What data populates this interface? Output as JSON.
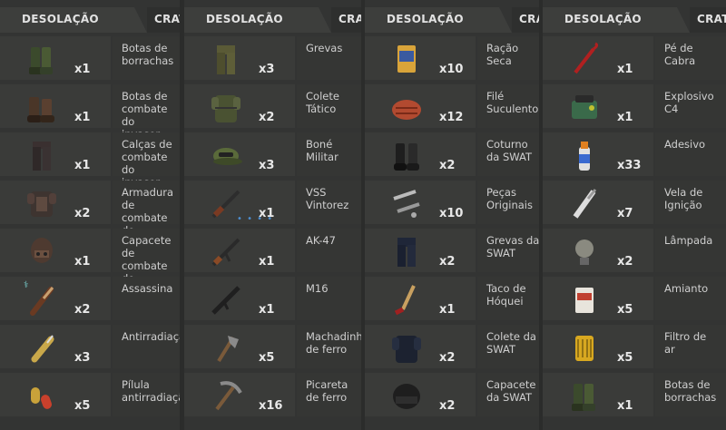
{
  "panels": [
    {
      "tab": "DESOLAÇÃO",
      "crate": "CRATE",
      "items": [
        {
          "name": "Botas de borrachas",
          "qty": "x1",
          "icon": "rubber-boots-icon"
        },
        {
          "name": "Botas de combate do invasor",
          "qty": "x1",
          "icon": "combat-boots-icon"
        },
        {
          "name": "Calças de combate do invasor",
          "qty": "x1",
          "icon": "combat-pants-icon"
        },
        {
          "name": "Armadura de combate do invasor",
          "qty": "x2",
          "icon": "combat-armor-icon"
        },
        {
          "name": "Capacete de combate do invasor",
          "qty": "x1",
          "icon": "combat-helmet-icon"
        },
        {
          "name": "Assassina",
          "qty": "x2",
          "icon": "assassin-knife-icon",
          "badge": "⚕"
        },
        {
          "name": "Antirradiação",
          "qty": "x3",
          "icon": "anti-radiation-icon"
        },
        {
          "name": "Pílula antirradiação",
          "qty": "x5",
          "icon": "pill-icon"
        }
      ]
    },
    {
      "tab": "DESOLAÇÃO",
      "crate": "CRATE",
      "items": [
        {
          "name": "Grevas",
          "qty": "x3",
          "icon": "greaves-icon"
        },
        {
          "name": "Colete Tático",
          "qty": "x2",
          "icon": "tactical-vest-icon"
        },
        {
          "name": "Boné Militar",
          "qty": "x3",
          "icon": "military-cap-icon"
        },
        {
          "name": "VSS Vintorez",
          "qty": "x1",
          "icon": "vss-rifle-icon",
          "dots": "• • • •"
        },
        {
          "name": "AK-47",
          "qty": "x1",
          "icon": "ak47-icon"
        },
        {
          "name": "M16",
          "qty": "x1",
          "icon": "m16-icon"
        },
        {
          "name": "Machadinha de ferro",
          "qty": "x5",
          "icon": "iron-hatchet-icon"
        },
        {
          "name": "Picareta de ferro",
          "qty": "x16",
          "icon": "iron-pickaxe-icon"
        }
      ]
    },
    {
      "tab": "DESOLAÇÃO",
      "crate": "CRATE",
      "items": [
        {
          "name": "Ração Seca",
          "qty": "x10",
          "icon": "dry-ration-icon"
        },
        {
          "name": "Filé Suculento",
          "qty": "x12",
          "icon": "steak-icon"
        },
        {
          "name": "Coturno da SWAT",
          "qty": "x2",
          "icon": "swat-boots-icon"
        },
        {
          "name": "Peças Originais",
          "qty": "x10",
          "icon": "original-parts-icon"
        },
        {
          "name": "Grevas da SWAT",
          "qty": "x2",
          "icon": "swat-greaves-icon"
        },
        {
          "name": "Taco de Hóquei",
          "qty": "x1",
          "icon": "hockey-stick-icon"
        },
        {
          "name": "Colete da SWAT",
          "qty": "x2",
          "icon": "swat-vest-icon"
        },
        {
          "name": "Capacete da SWAT",
          "qty": "x2",
          "icon": "swat-helmet-icon"
        }
      ]
    },
    {
      "tab": "DESOLAÇÃO",
      "crate": "CRATE",
      "items": [
        {
          "name": "Pé de Cabra",
          "qty": "x1",
          "icon": "crowbar-icon"
        },
        {
          "name": "Explosivo C4",
          "qty": "x1",
          "icon": "c4-explosive-icon"
        },
        {
          "name": "Adesivo",
          "qty": "x33",
          "icon": "adhesive-icon"
        },
        {
          "name": "Vela de Ignição",
          "qty": "x7",
          "icon": "spark-plug-icon"
        },
        {
          "name": "Lâmpada",
          "qty": "x2",
          "icon": "light-bulb-icon"
        },
        {
          "name": "Amianto",
          "qty": "x5",
          "icon": "asbestos-icon"
        },
        {
          "name": "Filtro de ar",
          "qty": "x5",
          "icon": "air-filter-icon"
        },
        {
          "name": "Botas de borrachas",
          "qty": "x1",
          "icon": "rubber-boots-icon"
        }
      ]
    }
  ]
}
